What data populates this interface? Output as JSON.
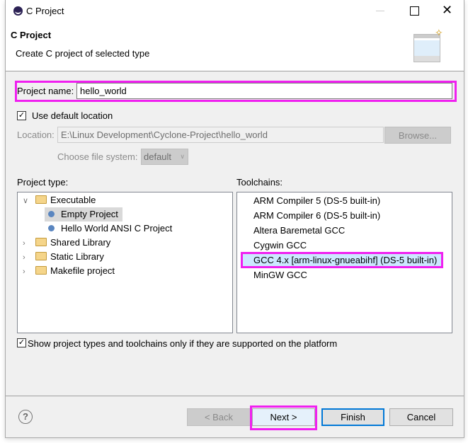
{
  "window": {
    "title": "C Project"
  },
  "header": {
    "title": "C Project",
    "subtitle": "Create C project of selected type"
  },
  "project_name": {
    "label": "Project name:",
    "value": "hello_world"
  },
  "use_default_location": {
    "label": "Use default location",
    "checked": true
  },
  "location": {
    "label": "Location:",
    "value": "E:\\Linux Development\\Cyclone-Project\\hello_world",
    "browse_label": "Browse..."
  },
  "file_system": {
    "label": "Choose file system:",
    "value": "default"
  },
  "project_type": {
    "label": "Project type:",
    "items": [
      {
        "label": "Executable",
        "expanded": true
      },
      {
        "label": "Empty Project",
        "selected": true
      },
      {
        "label": "Hello World ANSI C Project"
      },
      {
        "label": "Shared Library"
      },
      {
        "label": "Static Library"
      },
      {
        "label": "Makefile project"
      }
    ]
  },
  "toolchains": {
    "label": "Toolchains:",
    "items": [
      "ARM Compiler 5 (DS-5 built-in)",
      "ARM Compiler 6 (DS-5 built-in)",
      "Altera Baremetal GCC",
      "Cygwin GCC",
      "GCC 4.x [arm-linux-gnueabihf] (DS-5 built-in)",
      "MinGW GCC"
    ],
    "selected": "GCC 4.x [arm-linux-gnueabihf] (DS-5 built-in)"
  },
  "show_supported": {
    "label": "Show project types and toolchains only if they are supported on the platform",
    "checked": true
  },
  "buttons": {
    "back": "< Back",
    "next": "Next >",
    "finish": "Finish",
    "cancel": "Cancel"
  },
  "colors": {
    "highlight": "#f020f0",
    "focus": "#0078d7",
    "selection": "#cce8ff"
  }
}
